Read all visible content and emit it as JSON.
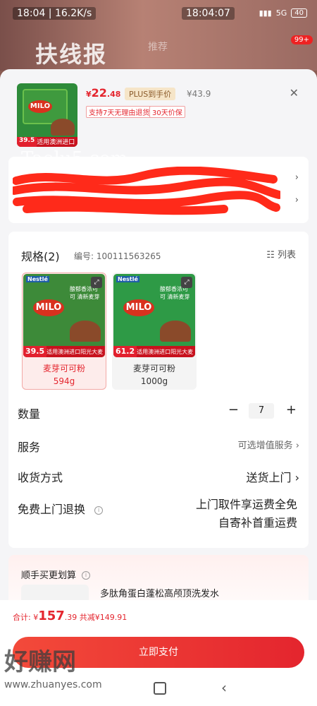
{
  "status_bar": {
    "left": "18:04 | 16.2K/s",
    "time": "18:04:07",
    "signal": "5G",
    "battery": "40"
  },
  "background": {
    "watermark": "扶线报",
    "mid_text": "推荐",
    "badge": "99+"
  },
  "product": {
    "price_prefix": "¥",
    "price_int": "22",
    "price_dec": ".48",
    "plus_label": "PLUS到手价",
    "original_price": "¥43.9",
    "tag1": "支持7天无理由退货",
    "tag2": "30天价保",
    "thumb_price": "39.5",
    "thumb_strip": "适用澳洲进口阳光大麦"
  },
  "address": {
    "line1_arrow": "›",
    "line2_arrow": "›"
  },
  "spec": {
    "title": "规格(2)",
    "number": "编号: 100111563265",
    "list_label": "列表",
    "variants": [
      {
        "brand": "Nestlé",
        "logo": "MILO",
        "desc": "酿郁香浓可可 清新麦芽",
        "price": "39.5",
        "strip": "适用澳洲进口阳光大麦",
        "name_line1": "麦芽可可粉",
        "name_line2": "594g"
      },
      {
        "brand": "Nestlé",
        "logo": "MILO",
        "desc": "酿郁香浓可可 清新麦芽",
        "price": "61.2",
        "strip": "适用澳洲进口阳光大麦",
        "name_line1": "麦芽可可粉",
        "name_line2": "1000g"
      }
    ]
  },
  "quantity": {
    "label": "数量",
    "minus": "−",
    "value": "7",
    "plus": "+"
  },
  "service": {
    "label": "服务",
    "value": "可选增值服务 ›"
  },
  "delivery": {
    "label": "收货方式",
    "value": "送货上门 ›"
  },
  "returns": {
    "label": "免费上门退换",
    "info": "i",
    "line1": "上门取件享运费全免",
    "line2": "自寄补首重运费"
  },
  "bundle": {
    "title": "顺手买更划算",
    "info": "i",
    "product_name": "多肽角蛋白蓬松高颅顶洗发水"
  },
  "footer": {
    "total_label": "合计: ",
    "total_symbol": "¥",
    "total_int": "157",
    "total_dec": ".39",
    "saving": " 共减¥149.91",
    "pay_button": "立即支付"
  },
  "watermarks": {
    "top": "Taolu5.com",
    "bottom_cn": "好赚网",
    "bottom_url": "www.zhuanyes.com"
  }
}
